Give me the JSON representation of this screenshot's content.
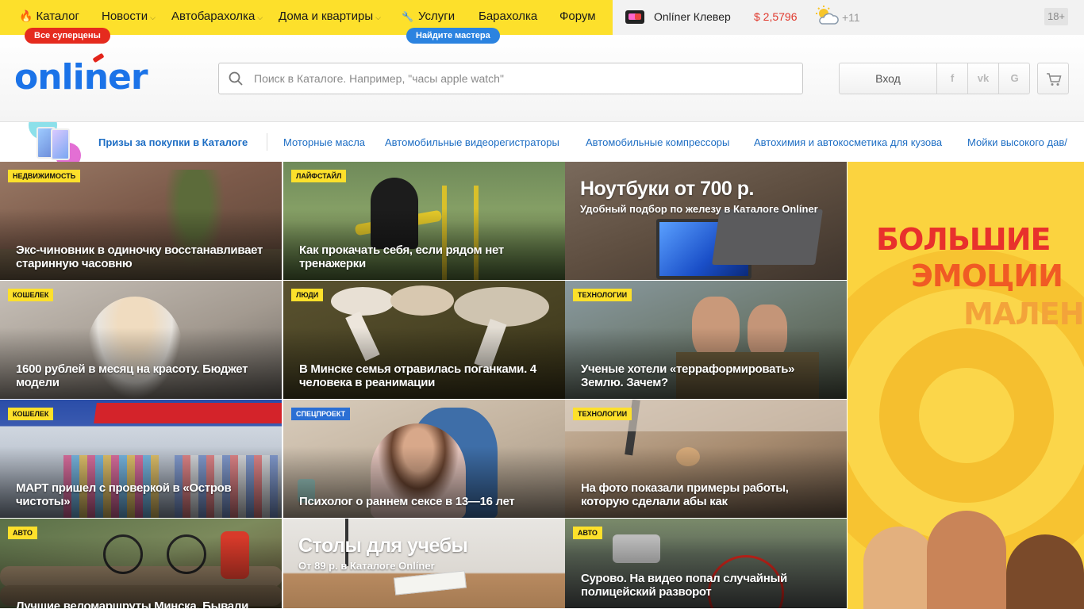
{
  "topbar": {
    "nav": [
      {
        "label": "Каталог",
        "icon": "fire-icon",
        "has_chevron": false
      },
      {
        "label": "Новости",
        "has_chevron": true
      },
      {
        "label": "Автобарахолка",
        "has_chevron": true
      },
      {
        "label": "Дома и квартиры",
        "has_chevron": true
      },
      {
        "label": "Услуги",
        "icon": "wrench-icon",
        "has_chevron": false
      },
      {
        "label": "Барахолка",
        "has_chevron": false
      },
      {
        "label": "Форум",
        "has_chevron": false
      }
    ],
    "badge_superprices": "Все суперцены",
    "badge_master": "Найдите мастера",
    "clever": "Onlíner Клевер",
    "rate": "$ 2,5796",
    "temperature": "+11",
    "age_limit": "18+",
    "colors": {
      "yellow": "#fde02b",
      "red": "#e52b1e",
      "blue": "#2b83e0"
    }
  },
  "header": {
    "logo": "onliner",
    "search_placeholder": "Поиск в Каталоге. Например, \"часы apple watch\"",
    "login": "Вход",
    "social": [
      "f",
      "vk",
      "G"
    ]
  },
  "subnav": {
    "promo": "Призы за покупки в Каталоге",
    "links": [
      "Моторные масла",
      "Автомобильные видеорегистраторы",
      "Автомобильные компрессоры",
      "Автохимия и автокосметика для кузова",
      "Мойки высокого дав/"
    ]
  },
  "news": [
    {
      "tag": "Недвижимость",
      "title": "Экс-чиновник в одиночку восстанавливает старинную часовню"
    },
    {
      "tag": "Лайфстайл",
      "title": "Как прокачать себя, если рядом нет тренажерки"
    },
    {
      "promo_title": "Ноутбуки от 700 р.",
      "promo_sub": "Удобный подбор по железу в Каталоге Onlíner"
    },
    {
      "tag": "Кошелек",
      "title": "1600 рублей в месяц на красоту. Бюджет модели"
    },
    {
      "tag": "Люди",
      "title": "В Минске семья отравилась поганками. 4 человека в реанимации"
    },
    {
      "tag": "Технологии",
      "title": "Ученые хотели «терраформировать» Землю. Зачем?"
    },
    {
      "tag": "Кошелек",
      "title": "МАРТ пришел с проверкой в «Остров чистоты»"
    },
    {
      "tag": "Спецпроект",
      "title": "Психолог о раннем сексе в 13—16 лет"
    },
    {
      "tag": "Технологии",
      "title": "На фото показали примеры работы, которую сделали абы как"
    },
    {
      "tag": "Авто",
      "title": "Лучшие веломаршруты Минска. Бывали"
    },
    {
      "promo_title": "Столы для учебы",
      "promo_sub": "От 89 р. в Каталоге Onlíner"
    },
    {
      "tag": "Авто",
      "title": "Сурово. На видео попал случайный полицейский разворот"
    }
  ],
  "ad": {
    "line1": "БОЛЬШИЕ",
    "line2": "ЭМОЦИИ",
    "line3": "МАЛЕНЬ"
  }
}
